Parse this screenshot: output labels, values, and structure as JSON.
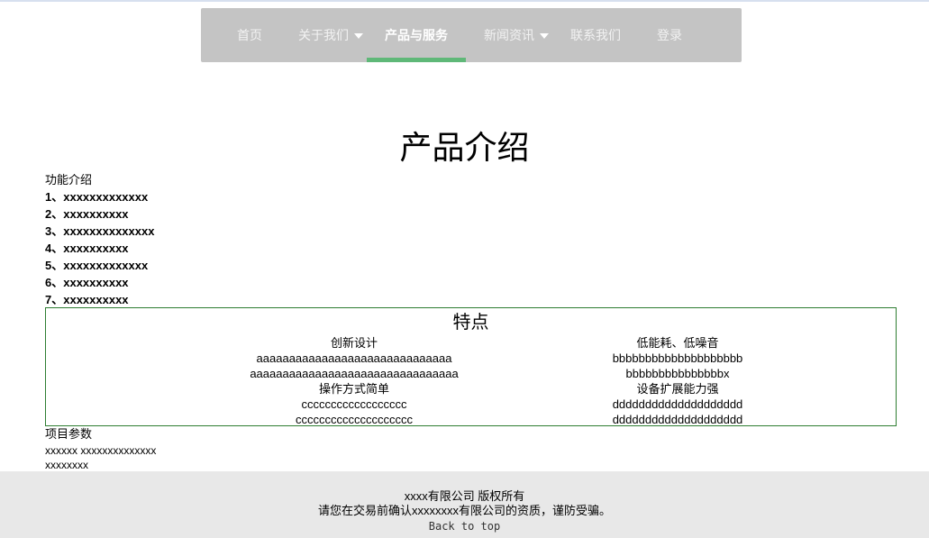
{
  "nav": {
    "items": [
      {
        "label": "首页",
        "has_dropdown": false,
        "active": false
      },
      {
        "label": "关于我们",
        "has_dropdown": true,
        "active": false
      },
      {
        "label": "产品与服务",
        "has_dropdown": false,
        "active": true
      },
      {
        "label": "新闻资讯",
        "has_dropdown": true,
        "active": false
      },
      {
        "label": "联系我们",
        "has_dropdown": false,
        "active": false
      },
      {
        "label": "登录",
        "has_dropdown": false,
        "active": false
      }
    ],
    "colors": {
      "bar": "#c4c4c4",
      "active_underline": "#5fb878"
    }
  },
  "page_title": "产品介绍",
  "features": {
    "heading": "功能介绍",
    "items": [
      "1、xxxxxxxxxxxxx",
      "2、xxxxxxxxxx",
      "3、xxxxxxxxxxxxxx",
      "4、xxxxxxxxxx",
      "5、xxxxxxxxxxxxx",
      "6、xxxxxxxxxx",
      "7、xxxxxxxxxx"
    ]
  },
  "highlights": {
    "title": "特点",
    "border_color": "#2e7d32",
    "left": [
      "创新设计",
      "aaaaaaaaaaaaaaaaaaaaaaaaaaaaaa",
      "aaaaaaaaaaaaaaaaaaaaaaaaaaaaaaaa",
      "操作方式简单",
      "cccccccccccccccccc",
      "cccccccccccccccccccc"
    ],
    "right": [
      "低能耗、低噪音",
      "bbbbbbbbbbbbbbbbbbbb",
      "bbbbbbbbbbbbbbbx",
      "设备扩展能力强",
      "dddddddddddddddddddd",
      "dddddddddddddddddddd"
    ]
  },
  "params": {
    "heading": "项目参数",
    "lines": [
      "xxxxxx xxxxxxxxxxxxxx",
      "xxxxxxxx"
    ]
  },
  "footer": {
    "copyright": "xxxx有限公司 版权所有",
    "notice": "请您在交易前确认xxxxxxxx有限公司的资质，谨防受骗。",
    "back_to_top": "Back to top",
    "background": "#e8e8e8"
  }
}
